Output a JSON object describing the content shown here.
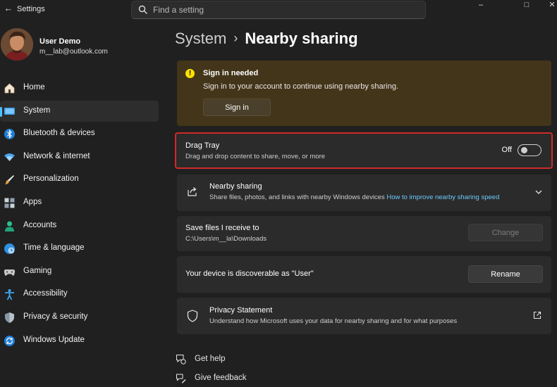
{
  "window": {
    "back_glyph": "←",
    "title": "Settings",
    "search_placeholder": "Find a setting",
    "controls": [
      "–",
      "□",
      "✕"
    ]
  },
  "profile": {
    "name": "User Demo",
    "email": "m__lab@outlook.com"
  },
  "sidebar": {
    "items": [
      {
        "label": "Home",
        "icon": "home-icon",
        "selected": false
      },
      {
        "label": "System",
        "icon": "system-icon",
        "selected": true
      },
      {
        "label": "Bluetooth & devices",
        "icon": "bluetooth-icon",
        "selected": false
      },
      {
        "label": "Network & internet",
        "icon": "wifi-icon",
        "selected": false
      },
      {
        "label": "Personalization",
        "icon": "brush-icon",
        "selected": false
      },
      {
        "label": "Apps",
        "icon": "apps-icon",
        "selected": false
      },
      {
        "label": "Accounts",
        "icon": "accounts-icon",
        "selected": false
      },
      {
        "label": "Time & language",
        "icon": "globe-icon",
        "selected": false
      },
      {
        "label": "Gaming",
        "icon": "gamepad-icon",
        "selected": false
      },
      {
        "label": "Accessibility",
        "icon": "accessibility-icon",
        "selected": false
      },
      {
        "label": "Privacy & security",
        "icon": "shield-icon",
        "selected": false
      },
      {
        "label": "Windows Update",
        "icon": "update-icon",
        "selected": false
      }
    ]
  },
  "breadcrumb": {
    "parent": "System",
    "separator": "›",
    "current": "Nearby sharing"
  },
  "banner": {
    "icon_glyph": "!",
    "title": "Sign in needed",
    "text": "Sign in to your account to continue using nearby sharing.",
    "button": "Sign in"
  },
  "drag_tray": {
    "title": "Drag Tray",
    "subtitle": "Drag and drop content to share, move, or more",
    "state_label": "Off",
    "enabled": false
  },
  "nearby_sharing": {
    "title": "Nearby sharing",
    "subtitle": "Share files, photos, and links with nearby Windows devices",
    "link": "How to improve nearby sharing speed"
  },
  "save_files": {
    "title": "Save files I receive to",
    "path": "C:\\Users\\m__la\\Downloads",
    "button": "Change"
  },
  "discoverable": {
    "text": "Your device is discoverable as \"User\"",
    "button": "Rename"
  },
  "privacy": {
    "title": "Privacy Statement",
    "subtitle": "Understand how Microsoft uses your data for nearby sharing and for what purposes"
  },
  "help_links": {
    "get_help": "Get help",
    "give_feedback": "Give feedback"
  },
  "colors": {
    "accent": "#4cc2ff",
    "link": "#6ccbff",
    "banner_bg": "#433519",
    "highlight_border": "#d12a2a"
  }
}
